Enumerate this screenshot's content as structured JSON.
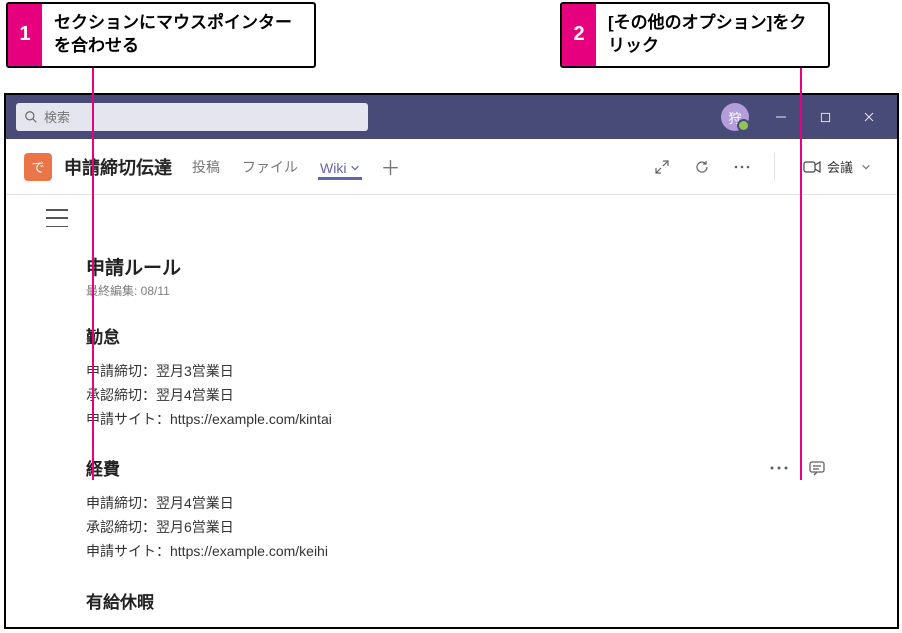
{
  "callouts": {
    "one": {
      "num": "1",
      "text": "セクションにマウスポインターを合わせる"
    },
    "two": {
      "num": "2",
      "text": "[その他のオプション]をクリック"
    }
  },
  "titlebar": {
    "search_placeholder": "検索",
    "avatar_initial": "狩"
  },
  "header": {
    "team_initial": "で",
    "channel_name": "申請締切伝達",
    "tabs": {
      "posts": "投稿",
      "files": "ファイル",
      "wiki": "Wiki"
    },
    "add_tab": "＋",
    "meet_label": "会議"
  },
  "wiki": {
    "page_title": "申請ルール",
    "last_edited": "最終編集: 08/11",
    "sections": [
      {
        "title": "勤怠",
        "lines": [
          "申請締切：翌月3営業日",
          "承認締切：翌月4営業日",
          "申請サイト：https://example.com/kintai"
        ],
        "hovered": false
      },
      {
        "title": "経費",
        "lines": [
          "申請締切：翌月4営業日",
          "承認締切：翌月6営業日",
          "申請サイト：https://example.com/keihi"
        ],
        "hovered": true
      },
      {
        "title": "有給休暇",
        "lines": [],
        "hovered": false
      }
    ]
  }
}
